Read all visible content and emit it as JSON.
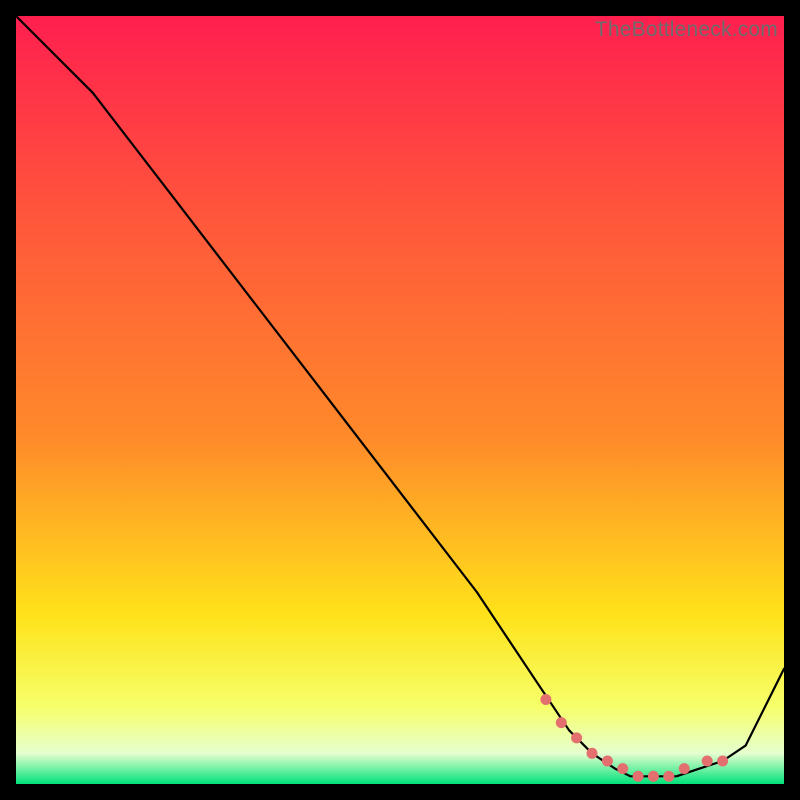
{
  "watermark": "TheBottleneck.com",
  "colors": {
    "top": "#ff1f4f",
    "mid_upper": "#ff8a2a",
    "mid": "#ffe21a",
    "mid_lower": "#f6ff6a",
    "bottom_band": "#e6ffcf",
    "bottom_edge": "#00e27a",
    "curve": "#000000",
    "marker_fill": "#e36f6f",
    "marker_stroke": "#a63c3c"
  },
  "chart_data": {
    "type": "line",
    "title": "",
    "xlabel": "",
    "ylabel": "",
    "xlim": [
      0,
      100
    ],
    "ylim": [
      0,
      100
    ],
    "grid": false,
    "series": [
      {
        "name": "bottleneck-curve",
        "x": [
          0,
          6,
          10,
          20,
          30,
          40,
          50,
          60,
          68,
          72,
          75,
          78,
          80,
          83,
          86,
          89,
          92,
          95,
          100
        ],
        "y": [
          100,
          94,
          90,
          77,
          64,
          51,
          38,
          25,
          13,
          7,
          4,
          2,
          1,
          1,
          1,
          2,
          3,
          5,
          15
        ]
      }
    ],
    "markers": {
      "name": "highlighted-range",
      "x": [
        69,
        71,
        73,
        75,
        77,
        79,
        81,
        83,
        85,
        87,
        90,
        92
      ],
      "y": [
        11,
        8,
        6,
        4,
        3,
        2,
        1,
        1,
        1,
        2,
        3,
        3
      ]
    }
  }
}
